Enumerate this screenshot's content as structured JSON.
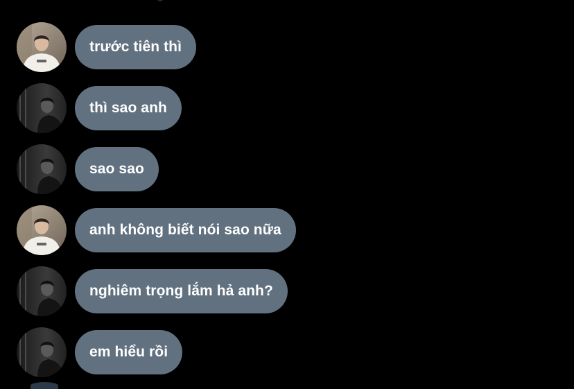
{
  "conversation": {
    "messages": [
      {
        "text": "trước tiên thì",
        "avatar": "user-a-avatar"
      },
      {
        "text": "thì sao anh",
        "avatar": "user-b-avatar"
      },
      {
        "text": "sao sao",
        "avatar": "user-b-avatar"
      },
      {
        "text": "anh không biết nói sao nữa",
        "avatar": "user-a-avatar"
      },
      {
        "text": "nghiêm trọng lắm hả anh?",
        "avatar": "user-b-avatar"
      },
      {
        "text": "em hiểu rồi",
        "avatar": "user-b-avatar"
      }
    ]
  },
  "colors": {
    "background": "#000000",
    "bubble": "#627180",
    "bubble_text": "#ffffff"
  }
}
